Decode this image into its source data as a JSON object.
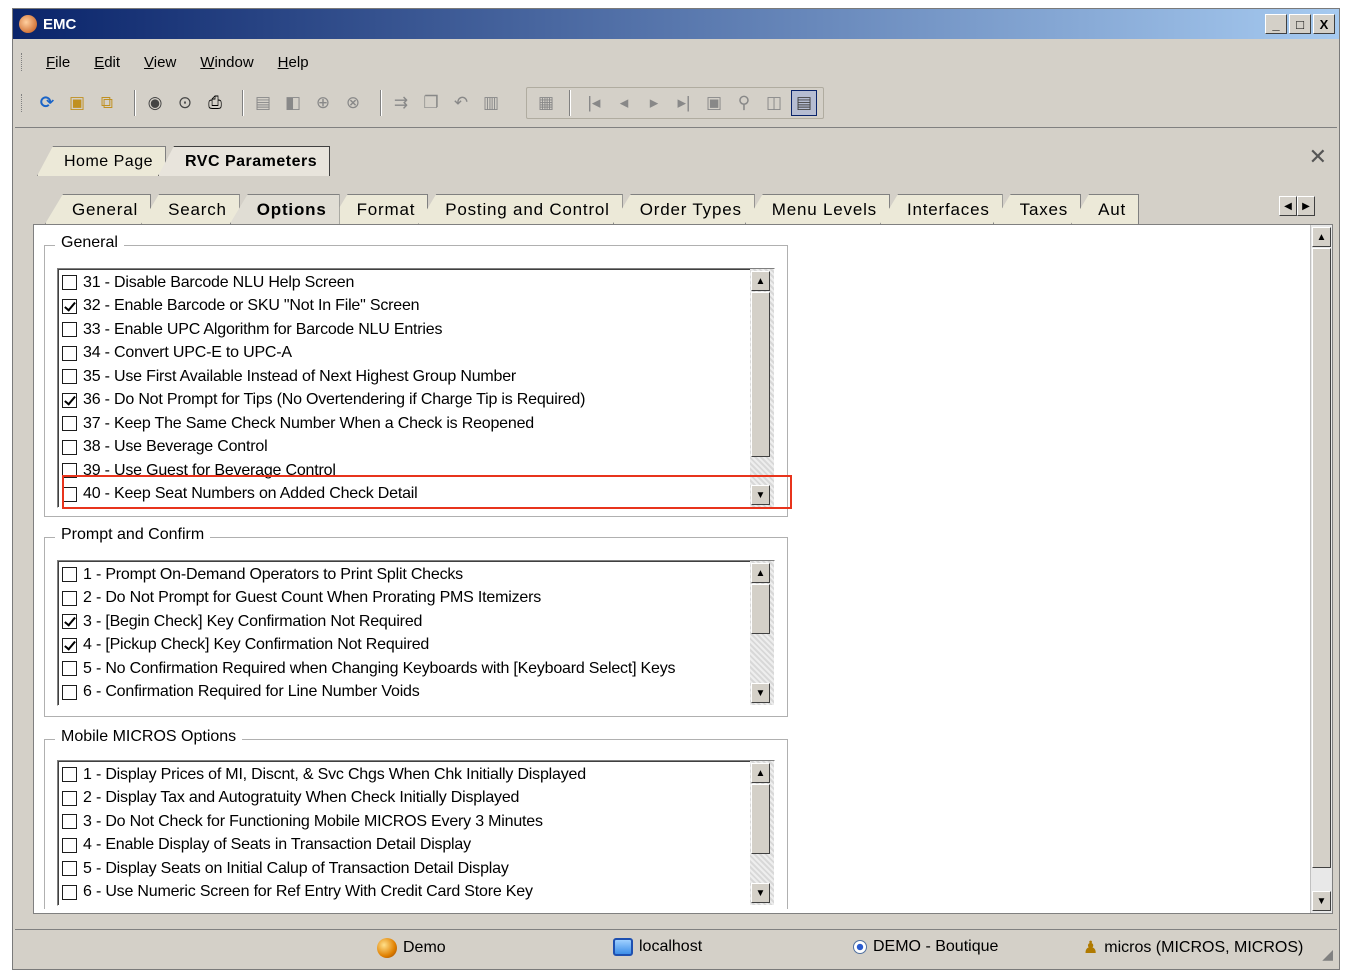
{
  "window": {
    "title": "EMC",
    "buttons": {
      "minimize": "_",
      "maximize": "□",
      "close": "X"
    }
  },
  "menu": [
    "File",
    "Edit",
    "View",
    "Window",
    "Help"
  ],
  "toolbar": {
    "icons": [
      "refresh-icon",
      "new-record-icon",
      "copy-record-icon",
      "radio-icon",
      "currency-icon",
      "print-icon",
      "save-icon",
      "save-all-icon",
      "add-icon",
      "delete-icon",
      "import-icon",
      "copy-icon",
      "undo-icon",
      "paste-icon",
      "table-icon",
      "first-icon",
      "prev-icon",
      "next-icon",
      "last-icon",
      "goto-icon",
      "find-icon",
      "view-icon",
      "grid-view-icon"
    ]
  },
  "doc_tabs": {
    "home": "Home Page",
    "rvc": "RVC Parameters",
    "close": "✕"
  },
  "sub_tabs": [
    "General",
    "Search",
    "Options",
    "Format",
    "Posting and Control",
    "Order Types",
    "Menu Levels",
    "Interfaces",
    "Taxes",
    "Aut"
  ],
  "active_sub_tab": "Options",
  "groups": {
    "general": {
      "title": "General",
      "items": [
        {
          "label": "31 - Disable Barcode NLU Help Screen",
          "checked": false
        },
        {
          "label": "32 - Enable Barcode or SKU \"Not In File\" Screen",
          "checked": true
        },
        {
          "label": "33 - Enable UPC Algorithm for Barcode NLU Entries",
          "checked": false
        },
        {
          "label": "34 - Convert UPC-E to UPC-A",
          "checked": false
        },
        {
          "label": "35 - Use First Available Instead of Next Highest Group Number",
          "checked": false
        },
        {
          "label": "36 - Do Not Prompt for Tips (No Overtendering if Charge Tip is Required)",
          "checked": true
        },
        {
          "label": "37 - Keep The Same Check Number When a Check is Reopened",
          "checked": false
        },
        {
          "label": "38 - Use Beverage Control",
          "checked": false
        },
        {
          "label": "39 - Use Guest for Beverage Control",
          "checked": false
        },
        {
          "label": "40 - Keep Seat Numbers on Added Check Detail",
          "checked": false
        }
      ]
    },
    "prompt": {
      "title": "Prompt and Confirm",
      "items": [
        {
          "label": "1 - Prompt On-Demand Operators to Print Split Checks",
          "checked": false
        },
        {
          "label": "2 - Do Not Prompt for Guest Count When Prorating PMS Itemizers",
          "checked": false
        },
        {
          "label": "3 - [Begin Check] Key Confirmation Not Required",
          "checked": true
        },
        {
          "label": "4 - [Pickup Check] Key Confirmation Not Required",
          "checked": true
        },
        {
          "label": "5 - No Confirmation Required when Changing Keyboards with [Keyboard Select] Keys",
          "checked": false
        },
        {
          "label": "6 - Confirmation Required for Line Number Voids",
          "checked": false
        }
      ]
    },
    "mobile": {
      "title": "Mobile MICROS Options",
      "items": [
        {
          "label": "1 - Display Prices of MI, Discnt, & Svc Chgs When Chk Initially Displayed",
          "checked": false
        },
        {
          "label": "2 - Display Tax and Autogratuity When Check Initially Displayed",
          "checked": false
        },
        {
          "label": "3 - Do Not Check for Functioning Mobile MICROS Every 3 Minutes",
          "checked": false
        },
        {
          "label": "4 - Enable Display of Seats in Transaction Detail Display",
          "checked": false
        },
        {
          "label": "5 - Display Seats on Initial Calup of Transaction Detail Display",
          "checked": false
        },
        {
          "label": "6 - Use Numeric Screen for Ref Entry With Credit Card Store Key",
          "checked": false
        }
      ]
    }
  },
  "status": {
    "db": "Demo",
    "host": "localhost",
    "property": "DEMO - Boutique",
    "user": "micros (MICROS, MICROS)"
  },
  "colors": {
    "highlight": "#e8341c",
    "title_start": "#0a246a",
    "title_end": "#a6caf0"
  }
}
